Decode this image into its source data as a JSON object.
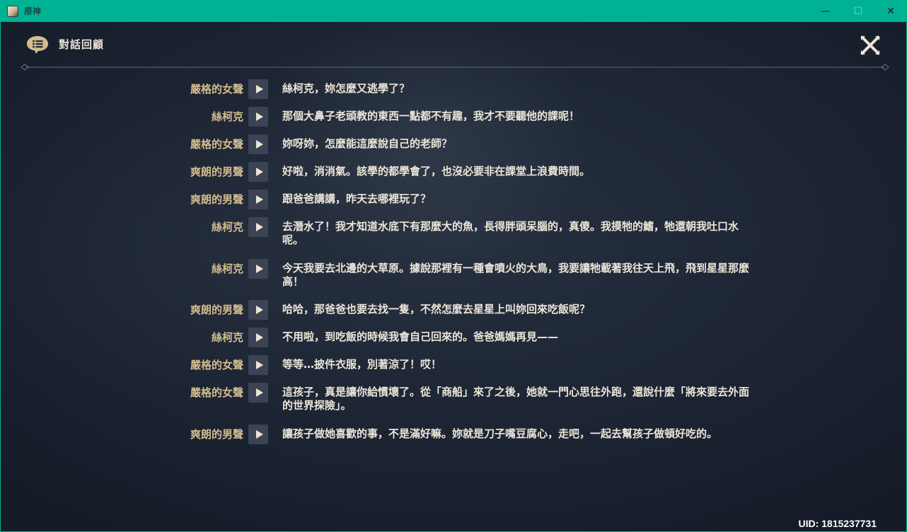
{
  "window": {
    "title": "原神",
    "controls": {
      "minimize": "—",
      "maximize": "☐",
      "close": "✕"
    }
  },
  "header": {
    "title": "對話回顧",
    "icons": {
      "dialogue": "chat-bubble-icon",
      "close": "close-x-icon"
    }
  },
  "dialogue": [
    {
      "speaker": "嚴格的女聲",
      "text": "絲柯克，妳怎麼又逃學了？"
    },
    {
      "speaker": "絲柯克",
      "text": "那個大鼻子老頭教的東西一點都不有趣，我才不要聽他的課呢！"
    },
    {
      "speaker": "嚴格的女聲",
      "text": "妳呀妳，怎麼能這麼說自己的老師？"
    },
    {
      "speaker": "爽朗的男聲",
      "text": "好啦，消消氣。該學的都學會了，也沒必要非在課堂上浪費時間。"
    },
    {
      "speaker": "爽朗的男聲",
      "text": "跟爸爸講講，昨天去哪裡玩了？"
    },
    {
      "speaker": "絲柯克",
      "text": "去潛水了！我才知道水底下有那麼大的魚，長得胖頭呆腦的，真傻。我摸牠的鰭，牠還朝我吐口水呢。"
    },
    {
      "speaker": "絲柯克",
      "text": "今天我要去北邊的大草原。據說那裡有一種會噴火的大鳥，我要讓牠載著我往天上飛，飛到星星那麼高！"
    },
    {
      "speaker": "爽朗的男聲",
      "text": "哈哈，那爸爸也要去找一隻，不然怎麼去星星上叫妳回來吃飯呢？"
    },
    {
      "speaker": "絲柯克",
      "text": "不用啦，到吃飯的時候我會自己回來的。爸爸媽媽再見——"
    },
    {
      "speaker": "嚴格的女聲",
      "text": "等等…披件衣服，別著涼了！哎！"
    },
    {
      "speaker": "嚴格的女聲",
      "text": "這孩子，真是讓你給慣壞了。從「商船」來了之後，她就一門心思往外跑，還說什麼「將來要去外面的世界探險」。"
    },
    {
      "speaker": "爽朗的男聲",
      "text": "讓孩子做她喜歡的事，不是滿好嘛。妳就是刀子嘴豆腐心，走吧，一起去幫孩子做頓好吃的。"
    }
  ],
  "uid": "UID: 1815237731",
  "colors": {
    "titlebar": "#00b294",
    "speaker": "#d3bc8e",
    "text": "#ece5d8",
    "play_button": "#3b4354"
  }
}
